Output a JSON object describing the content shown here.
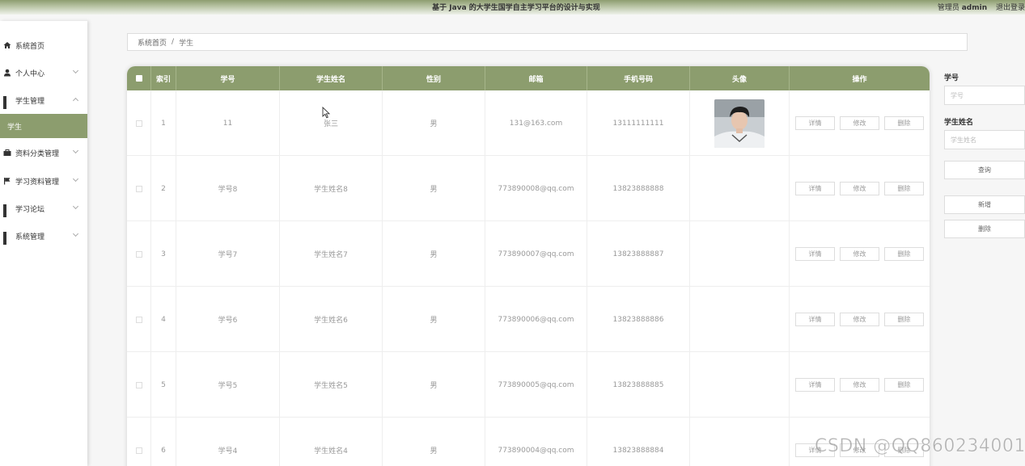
{
  "header": {
    "title": "基于 Java 的大学生国学自主学习平台的设计与实现",
    "role_prefix": "管理员",
    "username": "admin",
    "logout": "退出登录"
  },
  "sidebar": {
    "items": [
      {
        "label": "系统首页",
        "icon": "home-icon"
      },
      {
        "label": "个人中心",
        "icon": "user-icon"
      },
      {
        "label": "学生管理",
        "icon": "grid-icon"
      },
      {
        "label": "学生",
        "icon": ""
      },
      {
        "label": "资料分类管理",
        "icon": "briefcase-icon"
      },
      {
        "label": "学习资料管理",
        "icon": "flag-icon"
      },
      {
        "label": "学习论坛",
        "icon": "grid-icon"
      },
      {
        "label": "系统管理",
        "icon": "grid-icon"
      }
    ]
  },
  "breadcrumb": {
    "home": "系统首页",
    "separator": "/",
    "current": "学生"
  },
  "table": {
    "columns": [
      "",
      "索引",
      "学号",
      "学生姓名",
      "性别",
      "邮箱",
      "手机号码",
      "头像",
      "操作"
    ],
    "rows": [
      {
        "index": "1",
        "student_no": "11",
        "name": "张三",
        "gender": "男",
        "email": "131@163.com",
        "phone": "13111111111",
        "has_avatar": true
      },
      {
        "index": "2",
        "student_no": "学号8",
        "name": "学生姓名8",
        "gender": "男",
        "email": "773890008@qq.com",
        "phone": "13823888888",
        "has_avatar": false
      },
      {
        "index": "3",
        "student_no": "学号7",
        "name": "学生姓名7",
        "gender": "男",
        "email": "773890007@qq.com",
        "phone": "13823888887",
        "has_avatar": false
      },
      {
        "index": "4",
        "student_no": "学号6",
        "name": "学生姓名6",
        "gender": "男",
        "email": "773890006@qq.com",
        "phone": "13823888886",
        "has_avatar": false
      },
      {
        "index": "5",
        "student_no": "学号5",
        "name": "学生姓名5",
        "gender": "男",
        "email": "773890005@qq.com",
        "phone": "13823888885",
        "has_avatar": false
      },
      {
        "index": "6",
        "student_no": "学号4",
        "name": "学生姓名4",
        "gender": "男",
        "email": "773890004@qq.com",
        "phone": "13823888884",
        "has_avatar": false
      }
    ],
    "actions": {
      "detail": "详情",
      "edit": "修改",
      "delete": "删除"
    }
  },
  "search": {
    "student_no_label": "学号",
    "student_no_placeholder": "学号",
    "name_label": "学生姓名",
    "name_placeholder": "学生姓名",
    "query_button": "查询",
    "add_button": "新增",
    "delete_button": "删除"
  },
  "watermark": "CSDN @QQ860234001",
  "colors": {
    "accent": "#8c9d6e",
    "background": "#f6f6f6"
  }
}
